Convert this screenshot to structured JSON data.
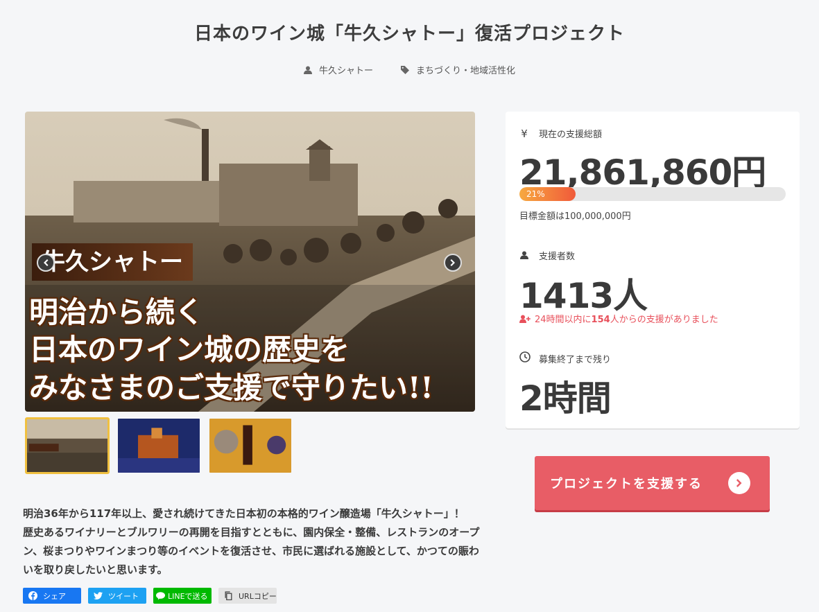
{
  "title": "日本のワイン城「牛久シャトー」復活プロジェクト",
  "meta": {
    "owner": "牛久シャトー",
    "category": "まちづくり・地域活性化"
  },
  "hero": {
    "label": "牛久シャトー",
    "line1": "明治から続く",
    "line2": "日本のワイン城の歴史を",
    "line3": "みなさまのご支援で守りたい!!"
  },
  "stats": {
    "amount_heading": "現在の支援総額",
    "amount": "21,861,860円",
    "progress_label": "21%",
    "progress_value": 0.21,
    "goal": "目標金額は100,000,000円",
    "supporters_heading": "支援者数",
    "supporters": "1413人",
    "recent_prefix": "24時間以内に",
    "recent_count": "154",
    "recent_suffix": "人からの支援がありました",
    "remaining_heading": "募集終了まで残り",
    "remaining": "2時間"
  },
  "support_button": "プロジェクトを支援する",
  "description": "明治36年から117年以上、愛され続けてきた日本初の本格的ワイン醸造場「牛久シャトー」！　歴史あるワイナリーとブルワリーの再開を目指すとともに、園内保全・整備、レストランのオープン、桜まつりやワインまつり等のイベントを復活させ、市民に選ばれる施設として、かつての賑わいを取り戻したいと思います。",
  "share": {
    "facebook": "シェア",
    "twitter": "ツイート",
    "line": "LINEで送る",
    "url": "URLコピー"
  },
  "colors": {
    "accent": "#e85d66",
    "recent": "#e8505b",
    "facebook": "#1877f2",
    "twitter": "#1da1f2",
    "line": "#00b900"
  }
}
